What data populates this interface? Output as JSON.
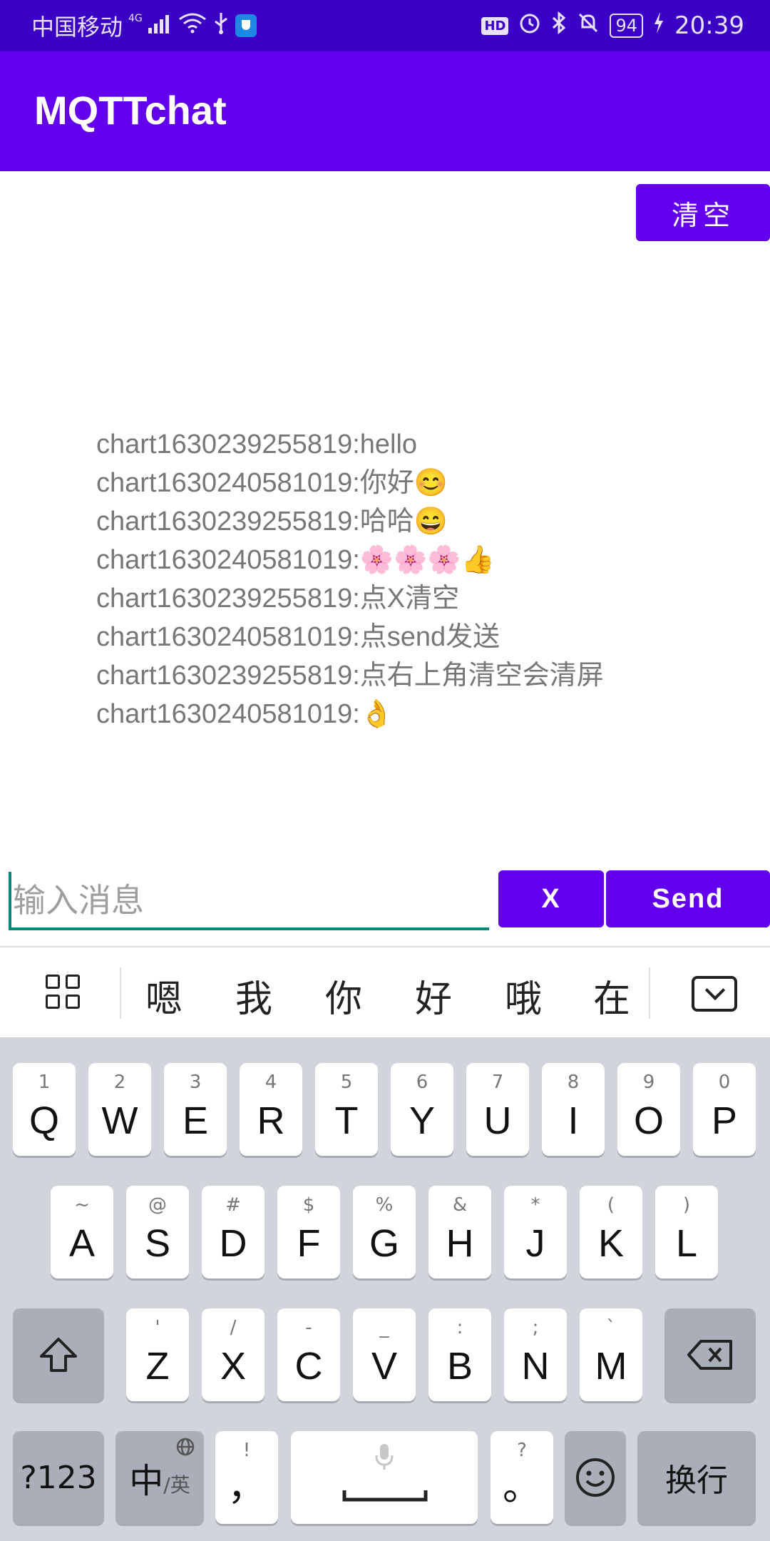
{
  "status_bar": {
    "carrier": "中国移动",
    "network": "4G",
    "time": "20:39",
    "battery": "94",
    "hd_label": "HD",
    "icons": [
      "signal-icon",
      "wifi-icon",
      "usb-icon",
      "shield-icon",
      "hd-icon",
      "alarm-icon",
      "bluetooth-icon",
      "mute-icon",
      "battery-icon",
      "charging-icon"
    ]
  },
  "app_bar": {
    "title": "MQTTchat"
  },
  "clear_button": "清空",
  "messages": [
    "chart1630239255819:hello",
    "chart1630240581019:你好😊",
    "chart1630239255819:哈哈😄",
    "chart1630240581019:🌸🌸🌸👍",
    "chart1630239255819:点X清空",
    "chart1630240581019:点send发送",
    "chart1630239255819:点右上角清空会清屏",
    "chart1630240581019:👌"
  ],
  "input": {
    "placeholder": "输入消息",
    "value": ""
  },
  "x_button": "X",
  "send_button": "Send",
  "keyboard": {
    "candidates": [
      "嗯",
      "我",
      "你",
      "好",
      "哦",
      "在"
    ],
    "row1": [
      {
        "sub": "1",
        "main": "Q"
      },
      {
        "sub": "2",
        "main": "W"
      },
      {
        "sub": "3",
        "main": "E"
      },
      {
        "sub": "4",
        "main": "R"
      },
      {
        "sub": "5",
        "main": "T"
      },
      {
        "sub": "6",
        "main": "Y"
      },
      {
        "sub": "7",
        "main": "U"
      },
      {
        "sub": "8",
        "main": "I"
      },
      {
        "sub": "9",
        "main": "O"
      },
      {
        "sub": "0",
        "main": "P"
      }
    ],
    "row2": [
      {
        "sub": "~",
        "main": "A"
      },
      {
        "sub": "@",
        "main": "S"
      },
      {
        "sub": "#",
        "main": "D"
      },
      {
        "sub": "$",
        "main": "F"
      },
      {
        "sub": "%",
        "main": "G"
      },
      {
        "sub": "&",
        "main": "H"
      },
      {
        "sub": "*",
        "main": "J"
      },
      {
        "sub": "(",
        "main": "K"
      },
      {
        "sub": ")",
        "main": "L"
      }
    ],
    "row3": [
      {
        "sub": "'",
        "main": "Z"
      },
      {
        "sub": "/",
        "main": "X"
      },
      {
        "sub": "-",
        "main": "C"
      },
      {
        "sub": "_",
        "main": "V"
      },
      {
        "sub": ":",
        "main": "B"
      },
      {
        "sub": ";",
        "main": "N"
      },
      {
        "sub": "`",
        "main": "M"
      }
    ],
    "symbols_key": "?123",
    "lang_key_main": "中",
    "lang_key_sub": "/英",
    "comma_key_sub": "!",
    "comma_key_main": "，",
    "period_key_sub": "?",
    "period_key_main": "。",
    "enter_key": "换行"
  }
}
